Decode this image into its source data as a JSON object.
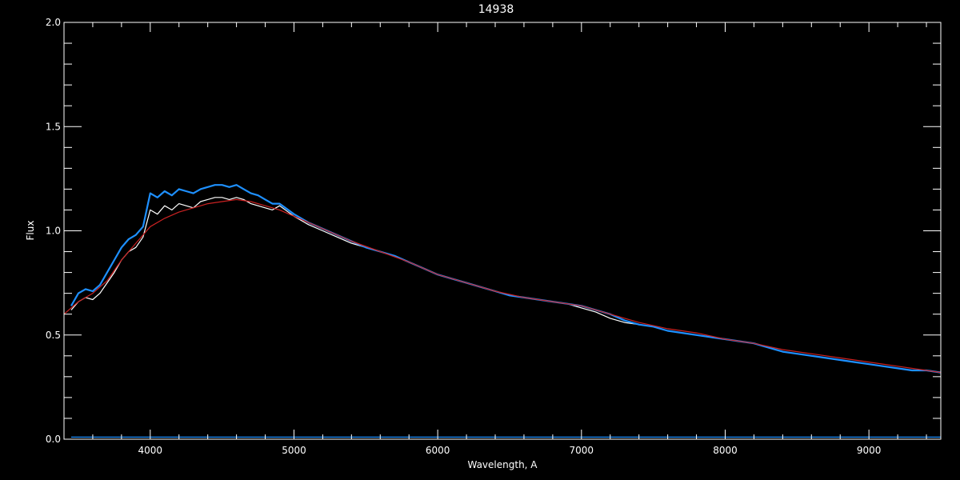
{
  "chart_data": {
    "type": "line",
    "title": "14938",
    "xlabel": "Wavelength, A",
    "ylabel": "Flux",
    "xlim": [
      3400,
      9500
    ],
    "ylim": [
      0,
      2
    ],
    "x_ticks": [
      4000,
      5000,
      6000,
      7000,
      8000,
      9000
    ],
    "x_tick_labels": [
      "4000",
      "5000",
      "6000",
      "7000",
      "8000",
      "9000"
    ],
    "y_ticks": [
      0,
      0.5,
      1,
      1.5,
      2
    ],
    "y_tick_labels": [
      "0.0",
      "0.5",
      "1.0",
      "1.5",
      "2.0"
    ],
    "grid": false,
    "colors": {
      "background": "#000000",
      "axes": "#ffffff",
      "observed": "#ffffff",
      "fit": "#1e90ff",
      "continuum": "#cc2222",
      "error": "#1e90ff"
    },
    "series": [
      {
        "key": "observed",
        "x": [
          3450,
          3500,
          3550,
          3600,
          3650,
          3700,
          3750,
          3800,
          3850,
          3900,
          3950,
          4000,
          4050,
          4100,
          4150,
          4200,
          4250,
          4300,
          4350,
          4400,
          4450,
          4500,
          4550,
          4600,
          4650,
          4700,
          4750,
          4800,
          4850,
          4900,
          5000,
          5100,
          5200,
          5300,
          5400,
          5500,
          5600,
          5700,
          5800,
          5900,
          6000,
          6100,
          6200,
          6300,
          6400,
          6500,
          6600,
          6700,
          6800,
          6900,
          7000,
          7100,
          7200,
          7300,
          7400,
          7500,
          7600,
          7700,
          7800,
          7900,
          8000,
          8100,
          8200,
          8300,
          8400,
          8500,
          8600,
          8700,
          8800,
          8900,
          9000,
          9100,
          9200,
          9300,
          9400,
          9500
        ],
        "y": [
          0.62,
          0.66,
          0.68,
          0.67,
          0.7,
          0.75,
          0.8,
          0.86,
          0.9,
          0.92,
          0.97,
          1.1,
          1.08,
          1.12,
          1.1,
          1.13,
          1.12,
          1.11,
          1.14,
          1.15,
          1.16,
          1.16,
          1.15,
          1.16,
          1.15,
          1.13,
          1.12,
          1.11,
          1.1,
          1.12,
          1.07,
          1.03,
          1.0,
          0.97,
          0.94,
          0.92,
          0.9,
          0.88,
          0.85,
          0.82,
          0.79,
          0.77,
          0.75,
          0.73,
          0.71,
          0.69,
          0.68,
          0.67,
          0.66,
          0.65,
          0.63,
          0.61,
          0.58,
          0.56,
          0.55,
          0.54,
          0.52,
          0.51,
          0.5,
          0.49,
          0.48,
          0.47,
          0.46,
          0.44,
          0.42,
          0.41,
          0.4,
          0.39,
          0.38,
          0.37,
          0.36,
          0.35,
          0.34,
          0.33,
          0.33,
          0.32
        ]
      },
      {
        "key": "fit",
        "x": [
          3450,
          3500,
          3550,
          3600,
          3650,
          3700,
          3750,
          3800,
          3850,
          3900,
          3950,
          4000,
          4050,
          4100,
          4150,
          4200,
          4250,
          4300,
          4350,
          4400,
          4450,
          4500,
          4550,
          4600,
          4650,
          4700,
          4750,
          4800,
          4850,
          4900,
          5000,
          5100,
          5200,
          5300,
          5400,
          5500,
          5600,
          5700,
          5800,
          5900,
          6000,
          6100,
          6200,
          6300,
          6400,
          6500,
          6600,
          6700,
          6800,
          6900,
          7000,
          7100,
          7200,
          7300,
          7400,
          7500,
          7600,
          7700,
          7800,
          7900,
          8000,
          8100,
          8200,
          8300,
          8400,
          8500,
          8600,
          8700,
          8800,
          8900,
          9000,
          9100,
          9200,
          9300,
          9400,
          9500
        ],
        "y": [
          0.64,
          0.7,
          0.72,
          0.71,
          0.74,
          0.8,
          0.86,
          0.92,
          0.96,
          0.98,
          1.02,
          1.18,
          1.16,
          1.19,
          1.17,
          1.2,
          1.19,
          1.18,
          1.2,
          1.21,
          1.22,
          1.22,
          1.21,
          1.22,
          1.2,
          1.18,
          1.17,
          1.15,
          1.13,
          1.13,
          1.08,
          1.04,
          1.01,
          0.98,
          0.95,
          0.92,
          0.9,
          0.88,
          0.85,
          0.82,
          0.79,
          0.77,
          0.75,
          0.73,
          0.71,
          0.69,
          0.68,
          0.67,
          0.66,
          0.65,
          0.64,
          0.62,
          0.6,
          0.57,
          0.55,
          0.54,
          0.52,
          0.51,
          0.5,
          0.49,
          0.48,
          0.47,
          0.46,
          0.44,
          0.42,
          0.41,
          0.4,
          0.39,
          0.38,
          0.37,
          0.36,
          0.35,
          0.34,
          0.33,
          0.33,
          0.32
        ]
      },
      {
        "key": "continuum",
        "x": [
          3400,
          3500,
          3600,
          3700,
          3800,
          3900,
          4000,
          4100,
          4200,
          4300,
          4400,
          4500,
          4600,
          4700,
          4800,
          4900,
          5000,
          5200,
          5400,
          5600,
          5800,
          6000,
          6200,
          6400,
          6600,
          6800,
          7000,
          7200,
          7400,
          7600,
          7800,
          8000,
          8200,
          8400,
          8600,
          8800,
          9000,
          9200,
          9400,
          9500
        ],
        "y": [
          0.6,
          0.66,
          0.7,
          0.76,
          0.86,
          0.94,
          1.02,
          1.06,
          1.09,
          1.11,
          1.13,
          1.14,
          1.15,
          1.14,
          1.12,
          1.1,
          1.07,
          1.01,
          0.95,
          0.9,
          0.85,
          0.79,
          0.75,
          0.71,
          0.68,
          0.66,
          0.64,
          0.6,
          0.56,
          0.53,
          0.51,
          0.48,
          0.46,
          0.43,
          0.41,
          0.39,
          0.37,
          0.35,
          0.33,
          0.32
        ]
      },
      {
        "key": "error",
        "x": [
          3450,
          4000,
          5000,
          6000,
          7000,
          8000,
          9000,
          9500
        ],
        "y": [
          0.01,
          0.01,
          0.01,
          0.01,
          0.01,
          0.01,
          0.01,
          0.01
        ]
      }
    ]
  }
}
